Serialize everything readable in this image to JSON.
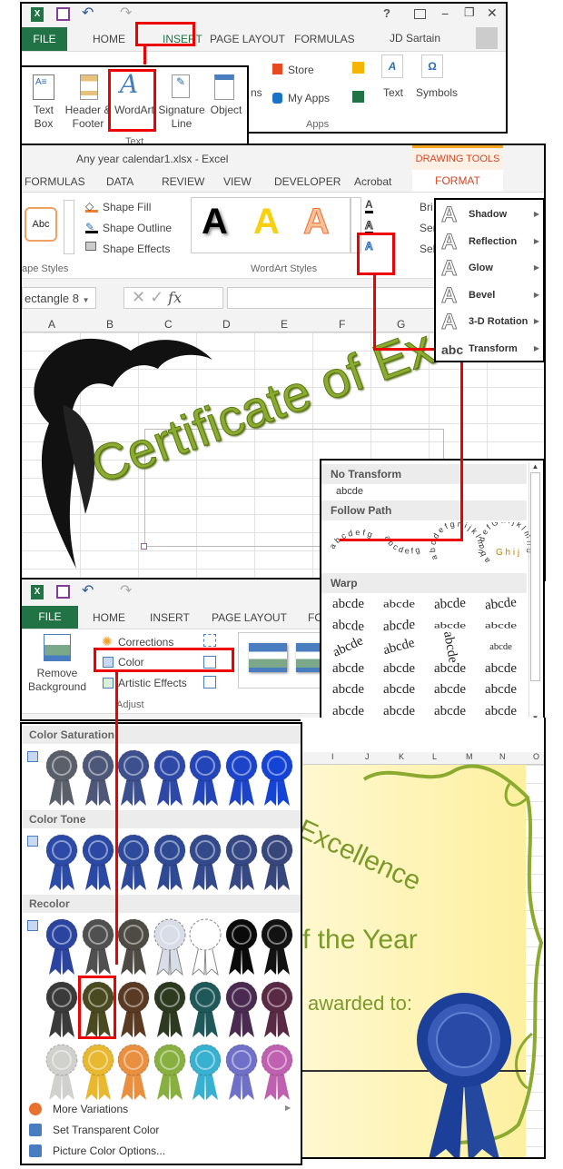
{
  "insert_window": {
    "tabs": [
      "FILE",
      "HOME",
      "INSERT",
      "PAGE LAYOUT",
      "FORMULAS"
    ],
    "active_tab": "INSERT",
    "user": "JD Sartain",
    "window_controls": [
      "?",
      "restore-ribbon",
      "−",
      "❐",
      "✕"
    ],
    "apps": {
      "store": "Store",
      "my_apps": "My Apps",
      "group": "Apps"
    },
    "text_btn": "Text",
    "symbols_btn": "Symbols",
    "partial_label": "ns"
  },
  "text_group": {
    "buttons": [
      {
        "label": "Text Box",
        "icon": "textbox-icon"
      },
      {
        "label": "Header & Footer",
        "icon": "header-footer-icon"
      },
      {
        "label": "WordArt",
        "icon": "wordart-icon"
      },
      {
        "label": "Signature Line",
        "icon": "signature-line-icon"
      },
      {
        "label": "Object",
        "icon": "object-icon"
      }
    ],
    "group": "Text"
  },
  "format_window": {
    "title": "Any year calendar1.xlsx - Excel",
    "context": "DRAWING TOOLS",
    "tabs": [
      "FORMULAS",
      "DATA",
      "REVIEW",
      "VIEW",
      "DEVELOPER",
      "Acrobat",
      "FORMAT"
    ],
    "active_tab": "FORMAT",
    "shape_style_sample": "Abc",
    "shape_fill": "Shape Fill",
    "shape_outline": "Shape Outline",
    "shape_effects": "Shape Effects",
    "shape_styles_group": "ape Styles",
    "wordart_group": "WordArt Styles",
    "arrange": [
      "Bri",
      "Sen",
      "Sel"
    ],
    "name_box": "ectangle 8",
    "fx": "fx",
    "columns": [
      "A",
      "B",
      "C",
      "D",
      "E",
      "F",
      "G"
    ],
    "wordart_text": "Certificate of Ex"
  },
  "text_effects_menu": [
    {
      "label": "Shadow"
    },
    {
      "label": "Reflection"
    },
    {
      "label": "Glow"
    },
    {
      "label": "Bevel"
    },
    {
      "label": "3-D Rotation"
    },
    {
      "label": "Transform"
    }
  ],
  "transform_gallery": {
    "no_transform": "No Transform",
    "sample": "abcde",
    "follow_path": "Follow Path",
    "path_samples": [
      "abcdefg",
      "abcdefg",
      "abcdefghijklmn",
      "abcdefGhijklmno"
    ],
    "warp": "Warp"
  },
  "picture_window": {
    "tabs": [
      "FILE",
      "HOME",
      "INSERT",
      "PAGE LAYOUT",
      "FO"
    ],
    "remove_background": "Remove Background",
    "corrections": "Corrections",
    "color": "Color",
    "artistic_effects": "Artistic Effects",
    "group": "Adjust",
    "columns": [
      "I",
      "J",
      "K",
      "L",
      "M",
      "N",
      "O"
    ]
  },
  "certificate": {
    "line1": "Excellence",
    "line2": "f the Year",
    "line3": "awarded to:"
  },
  "color_menu": {
    "sections": [
      {
        "title": "Color Saturation",
        "rows": [
          [
            "#5a5f6a",
            "#4d5777",
            "#3c4f8e",
            "#2e48a6",
            "#2445b8",
            "#1c44c8",
            "#1444d6"
          ]
        ]
      },
      {
        "title": "Color Tone",
        "rows": [
          [
            "#2c4aa8",
            "#2a48a4",
            "#2d4a9c",
            "#2f4a94",
            "#32498c",
            "#354884",
            "#37477c"
          ]
        ]
      },
      {
        "title": "Recolor",
        "rows": [
          [
            "#2a44a0",
            "#505050",
            "#4e4a44",
            "#d8dde8",
            "#ffffff",
            "#0a0a0a",
            "#121212"
          ],
          [
            "#3a3a3a",
            "#4a4a20",
            "#5a3a22",
            "#2e3a20",
            "#1e5858",
            "#4a2a50",
            "#5a2a44"
          ],
          [
            "#d0d0cc",
            "#e8b830",
            "#e89040",
            "#88b040",
            "#38b0d0",
            "#7070c8",
            "#c060b0"
          ]
        ]
      }
    ],
    "selected": {
      "section": 2,
      "row": 1,
      "col": 1
    },
    "footer": [
      {
        "label": "More Variations",
        "icon": "color-wheel-icon"
      },
      {
        "label": "Set Transparent Color",
        "icon": "set-transparent-icon"
      },
      {
        "label": "Picture Color Options...",
        "icon": "picture-color-icon"
      }
    ]
  },
  "colors": {
    "excel_green": "#217346",
    "highlight": "#e00000",
    "format_orange": "#d24726",
    "wordart_green": "#7a9a2a"
  }
}
